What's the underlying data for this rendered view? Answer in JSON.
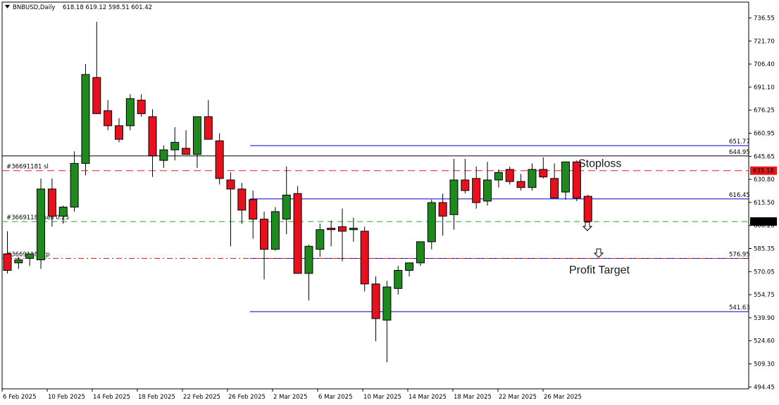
{
  "header": {
    "symbol": "BNBUSD,Daily",
    "ohlc": "618.18 619.12 598.51 601.42"
  },
  "colors": {
    "bull": "#1e8a1e",
    "bear": "#e8101c",
    "axis": "#000000",
    "level": "#0000cc",
    "sl": "#e81818",
    "tp": "#e81818",
    "entry": "#22aa22"
  },
  "chart_data": {
    "type": "candlestick",
    "symbol": "BNBUSD",
    "timeframe": "Daily",
    "ylim": [
      494.45,
      743.0
    ],
    "price_ticks": [
      "736.55",
      "721.70",
      "706.40",
      "691.10",
      "676.25",
      "660.95",
      "645.65",
      "630.80",
      "615.50",
      "600.20",
      "585.35",
      "570.05",
      "554.75",
      "539.90",
      "524.60",
      "509.30",
      "494.45"
    ],
    "date_ticks": [
      "6 Feb 2025",
      "10 Feb 2025",
      "14 Feb 2025",
      "18 Feb 2025",
      "22 Feb 2025",
      "26 Feb 2025",
      "2 Mar 2025",
      "6 Mar 2025",
      "10 Mar 2025",
      "14 Mar 2025",
      "18 Mar 2025",
      "22 Mar 2025",
      "26 Mar 2025"
    ],
    "candles": [
      {
        "o": 580,
        "h": 595,
        "l": 567,
        "c": 569
      },
      {
        "o": 574,
        "h": 578,
        "l": 570,
        "c": 576
      },
      {
        "o": 577,
        "h": 580,
        "l": 572,
        "c": 580
      },
      {
        "o": 576,
        "h": 630,
        "l": 570,
        "c": 623
      },
      {
        "o": 623,
        "h": 630,
        "l": 598,
        "c": 605
      },
      {
        "o": 605,
        "h": 612,
        "l": 600,
        "c": 611
      },
      {
        "o": 611,
        "h": 648,
        "l": 608,
        "c": 640
      },
      {
        "o": 640,
        "h": 706,
        "l": 632,
        "c": 699
      },
      {
        "o": 697,
        "h": 734,
        "l": 676,
        "c": 673
      },
      {
        "o": 675,
        "h": 682,
        "l": 662,
        "c": 665
      },
      {
        "o": 665,
        "h": 670,
        "l": 654,
        "c": 656
      },
      {
        "o": 665,
        "h": 686,
        "l": 662,
        "c": 683
      },
      {
        "o": 682,
        "h": 686,
        "l": 671,
        "c": 673
      },
      {
        "o": 671,
        "h": 676,
        "l": 631,
        "c": 645
      },
      {
        "o": 642,
        "h": 652,
        "l": 637,
        "c": 649
      },
      {
        "o": 649,
        "h": 664,
        "l": 642,
        "c": 654
      },
      {
        "o": 650,
        "h": 662,
        "l": 648,
        "c": 646
      },
      {
        "o": 646,
        "h": 670,
        "l": 637,
        "c": 671
      },
      {
        "o": 671,
        "h": 682,
        "l": 656,
        "c": 656
      },
      {
        "o": 655,
        "h": 660,
        "l": 626,
        "c": 630
      },
      {
        "o": 629,
        "h": 634,
        "l": 585,
        "c": 623
      },
      {
        "o": 623,
        "h": 627,
        "l": 600,
        "c": 609
      },
      {
        "o": 616,
        "h": 622,
        "l": 590,
        "c": 603
      },
      {
        "o": 603,
        "h": 608,
        "l": 563,
        "c": 583
      },
      {
        "o": 583,
        "h": 611,
        "l": 582,
        "c": 608
      },
      {
        "o": 603,
        "h": 638,
        "l": 593,
        "c": 619
      },
      {
        "o": 620,
        "h": 625,
        "l": 567,
        "c": 567
      },
      {
        "o": 567,
        "h": 586,
        "l": 549,
        "c": 585
      },
      {
        "o": 583,
        "h": 600,
        "l": 578,
        "c": 596
      },
      {
        "o": 597,
        "h": 602,
        "l": 585,
        "c": 596
      },
      {
        "o": 598,
        "h": 610,
        "l": 575,
        "c": 595
      },
      {
        "o": 596,
        "h": 604,
        "l": 588,
        "c": 597
      },
      {
        "o": 595,
        "h": 598,
        "l": 555,
        "c": 560
      },
      {
        "o": 560,
        "h": 565,
        "l": 522,
        "c": 537
      },
      {
        "o": 536,
        "h": 562,
        "l": 508,
        "c": 558
      },
      {
        "o": 557,
        "h": 572,
        "l": 553,
        "c": 569
      },
      {
        "o": 569,
        "h": 574,
        "l": 565,
        "c": 574
      },
      {
        "o": 574,
        "h": 588,
        "l": 572,
        "c": 588
      },
      {
        "o": 588,
        "h": 616,
        "l": 583,
        "c": 614
      },
      {
        "o": 614,
        "h": 620,
        "l": 592,
        "c": 605
      },
      {
        "o": 606,
        "h": 643,
        "l": 596,
        "c": 629
      },
      {
        "o": 629,
        "h": 643,
        "l": 620,
        "c": 622
      },
      {
        "o": 630,
        "h": 638,
        "l": 610,
        "c": 614
      },
      {
        "o": 615,
        "h": 641,
        "l": 612,
        "c": 629
      },
      {
        "o": 629,
        "h": 636,
        "l": 624,
        "c": 634
      },
      {
        "o": 636,
        "h": 638,
        "l": 626,
        "c": 628
      },
      {
        "o": 628,
        "h": 633,
        "l": 622,
        "c": 624
      },
      {
        "o": 624,
        "h": 640,
        "l": 622,
        "c": 636
      },
      {
        "o": 636,
        "h": 644,
        "l": 630,
        "c": 631
      },
      {
        "o": 630,
        "h": 640,
        "l": 620,
        "c": 617
      },
      {
        "o": 621,
        "h": 641,
        "l": 616,
        "c": 641
      },
      {
        "o": 641,
        "h": 642,
        "l": 615,
        "c": 617
      },
      {
        "o": 618.18,
        "h": 619.12,
        "l": 598.51,
        "c": 601.42
      }
    ],
    "levels": [
      {
        "price": 651.77,
        "label": "651.77",
        "kind": "level"
      },
      {
        "price": 644.95,
        "label": "644.95",
        "kind": "horizontal"
      },
      {
        "price": 616.45,
        "label": "616.45",
        "kind": "level"
      },
      {
        "price": 576.95,
        "label": "576.95",
        "kind": "level"
      },
      {
        "price": 541.63,
        "label": "541.63",
        "kind": "level"
      }
    ],
    "orders": [
      {
        "price": 635.18,
        "label": "635.18",
        "text": "#36691181 sl",
        "kind": "sl"
      },
      {
        "price": 601.42,
        "label": "601.42",
        "text": "#36691181 sell 0.25",
        "kind": "entry"
      },
      {
        "price": 576.95,
        "label": "",
        "text": "#36691181 tp",
        "kind": "tp"
      }
    ],
    "annotations": [
      {
        "text": "Stoploss",
        "price": 639
      },
      {
        "text": "Profit Target",
        "price": 573
      }
    ]
  }
}
